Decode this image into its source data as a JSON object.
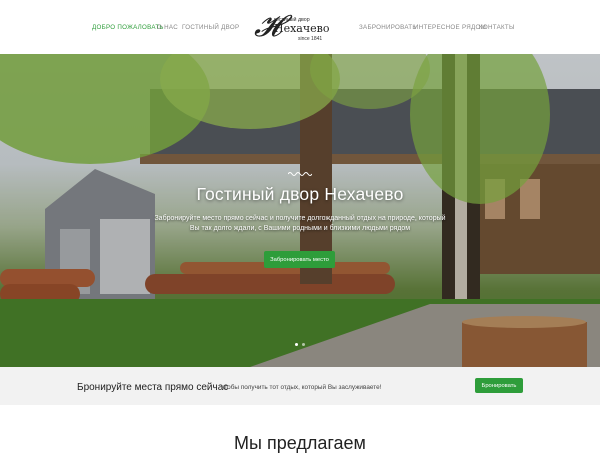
{
  "header": {
    "nav_left": [
      {
        "label": "ДОБРО ПОЖАЛОВАТЬ",
        "active": true
      },
      {
        "label": "О НАС",
        "active": false
      },
      {
        "label": "ГОСТИНЫЙ ДВОР",
        "active": false
      }
    ],
    "nav_right": [
      {
        "label": "ЗАБРОНИРОВАТЬ",
        "active": false
      },
      {
        "label": "ИНТЕРЕСНОЕ РЯДОМ",
        "active": false
      },
      {
        "label": "КОНТАКТЫ",
        "active": false
      }
    ],
    "logo": {
      "top": "гостиный двор",
      "main": "Нехачево",
      "since": "since 1841"
    }
  },
  "hero": {
    "title": "Гостиный двор Нехачево",
    "subtitle": "Забронируйте место прямо сейчас и получите долгожданный отдых на природе, который Вы так долго ждали, с Вашими родными и близкими людьми рядом",
    "button": "Забронировать место",
    "slides_total": 2,
    "slide_active": 1
  },
  "booking": {
    "title": "Бронируйте места прямо сейчас",
    "note": "чтобы получить тот отдых, который Вы заслуживаете!",
    "button": "Бронировать"
  },
  "offer": {
    "title": "Мы предлагаем"
  },
  "colors": {
    "accent": "#2e9d3a",
    "nav_text": "#888888",
    "booking_bg": "#f2f2f2"
  }
}
